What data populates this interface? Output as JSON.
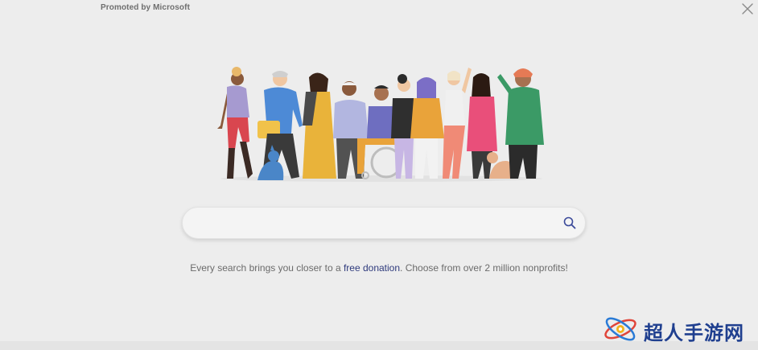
{
  "header": {
    "promo_label": "Promoted by Microsoft"
  },
  "illustration": {
    "description_icon": "diverse-people-illustration"
  },
  "search": {
    "value": "",
    "placeholder": "",
    "icon": "search-icon"
  },
  "tagline": {
    "before": "Every search brings you closer to a ",
    "link": "free donation",
    "after": ". Choose from over 2 million nonprofits!"
  },
  "watermark": {
    "text": "超人手游网"
  },
  "colors": {
    "background": "#ededed",
    "link": "#2e3a7c",
    "search_icon": "#3b4a9a",
    "watermark": "#1f3f8f"
  }
}
